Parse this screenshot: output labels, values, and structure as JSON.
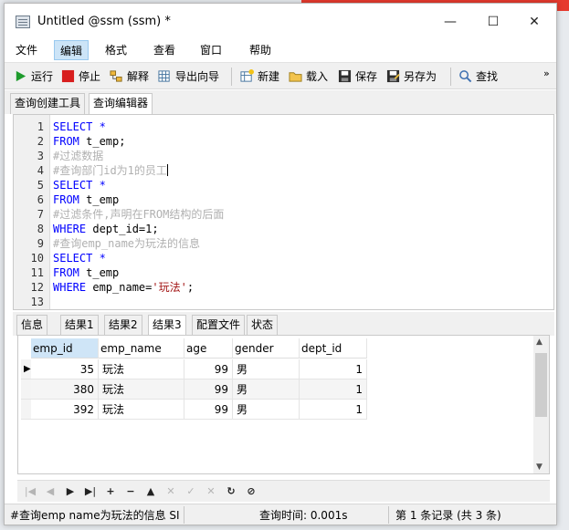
{
  "window": {
    "title": "Untitled @ssm (ssm) *",
    "controls": {
      "minimize": "—",
      "maximize": "☐",
      "close": "✕"
    }
  },
  "menu": [
    "文件",
    "编辑",
    "格式",
    "查看",
    "窗口",
    "帮助"
  ],
  "menu_active_index": 1,
  "toolbar": {
    "run": "运行",
    "stop": "停止",
    "explain": "解释",
    "export_wizard": "导出向导",
    "new": "新建",
    "load": "载入",
    "save": "保存",
    "save_as": "另存为",
    "find": "查找",
    "overflow": "»"
  },
  "query_tabs": [
    "查询创建工具",
    "查询编辑器"
  ],
  "query_tabs_active_index": 1,
  "editor": {
    "line_numbers": [
      "1",
      "2",
      "3",
      "4",
      "5",
      "6",
      "7",
      "8",
      "9",
      "10",
      "11",
      "12",
      "13"
    ],
    "lines": [
      [
        {
          "t": "SELECT",
          "c": "kw"
        },
        {
          "t": " *",
          "c": "kw"
        }
      ],
      [
        {
          "t": "FROM",
          "c": "kw"
        },
        {
          "t": " t_emp;",
          "c": ""
        }
      ],
      [
        {
          "t": "#过滤数据",
          "c": "cm"
        }
      ],
      [
        {
          "t": "#查询部门id为1的员工",
          "c": "cm"
        }
      ],
      [
        {
          "t": "SELECT",
          "c": "kw"
        },
        {
          "t": " *",
          "c": "kw"
        }
      ],
      [
        {
          "t": "FROM",
          "c": "kw"
        },
        {
          "t": " t_emp",
          "c": ""
        }
      ],
      [
        {
          "t": "#过滤条件,声明在FROM结构的后面",
          "c": "cm"
        }
      ],
      [
        {
          "t": "WHERE",
          "c": "kw"
        },
        {
          "t": " dept_id=1;",
          "c": ""
        }
      ],
      [
        {
          "t": "#查询emp_name为玩法的信息",
          "c": "cm"
        }
      ],
      [
        {
          "t": "SELECT",
          "c": "kw"
        },
        {
          "t": " *",
          "c": "kw"
        }
      ],
      [
        {
          "t": "FROM",
          "c": "kw"
        },
        {
          "t": " t_emp",
          "c": ""
        }
      ],
      [
        {
          "t": "WHERE",
          "c": "kw"
        },
        {
          "t": " emp_name=",
          "c": ""
        },
        {
          "t": "'玩法'",
          "c": "str"
        },
        {
          "t": ";",
          "c": ""
        }
      ],
      []
    ]
  },
  "result_tabs": [
    "信息",
    "结果1",
    "结果2",
    "结果3",
    "配置文件",
    "状态"
  ],
  "result_tabs_active_index": 3,
  "grid": {
    "columns": [
      "emp_id",
      "emp_name",
      "age",
      "gender",
      "dept_id"
    ],
    "rows": [
      [
        "35",
        "玩法",
        "99",
        "男",
        "1"
      ],
      [
        "380",
        "玩法",
        "99",
        "男",
        "1"
      ],
      [
        "392",
        "玩法",
        "99",
        "男",
        "1"
      ]
    ]
  },
  "navbar": [
    "|◀",
    "◀",
    "▶",
    "▶|",
    "+",
    "−",
    "▲",
    "✕",
    "✓",
    "✕",
    "↻",
    "⊘"
  ],
  "status": {
    "sql": "#查询emp name为玩法的信息 SI",
    "query_time": "查询时间: 0.001s",
    "records": "第 1 条记录 (共 3 条)"
  },
  "colors": {
    "keyword": "#0000ff",
    "comment": "#b0b0b0",
    "string": "#a31515",
    "selection": "#cfe5f7"
  },
  "icons": {
    "run": "play-icon",
    "stop": "stop-icon",
    "explain": "explain-icon",
    "export_wizard": "export-icon",
    "new": "new-query-icon",
    "load": "folder-icon",
    "save": "save-icon",
    "save_as": "save-as-icon",
    "find": "search-icon"
  }
}
